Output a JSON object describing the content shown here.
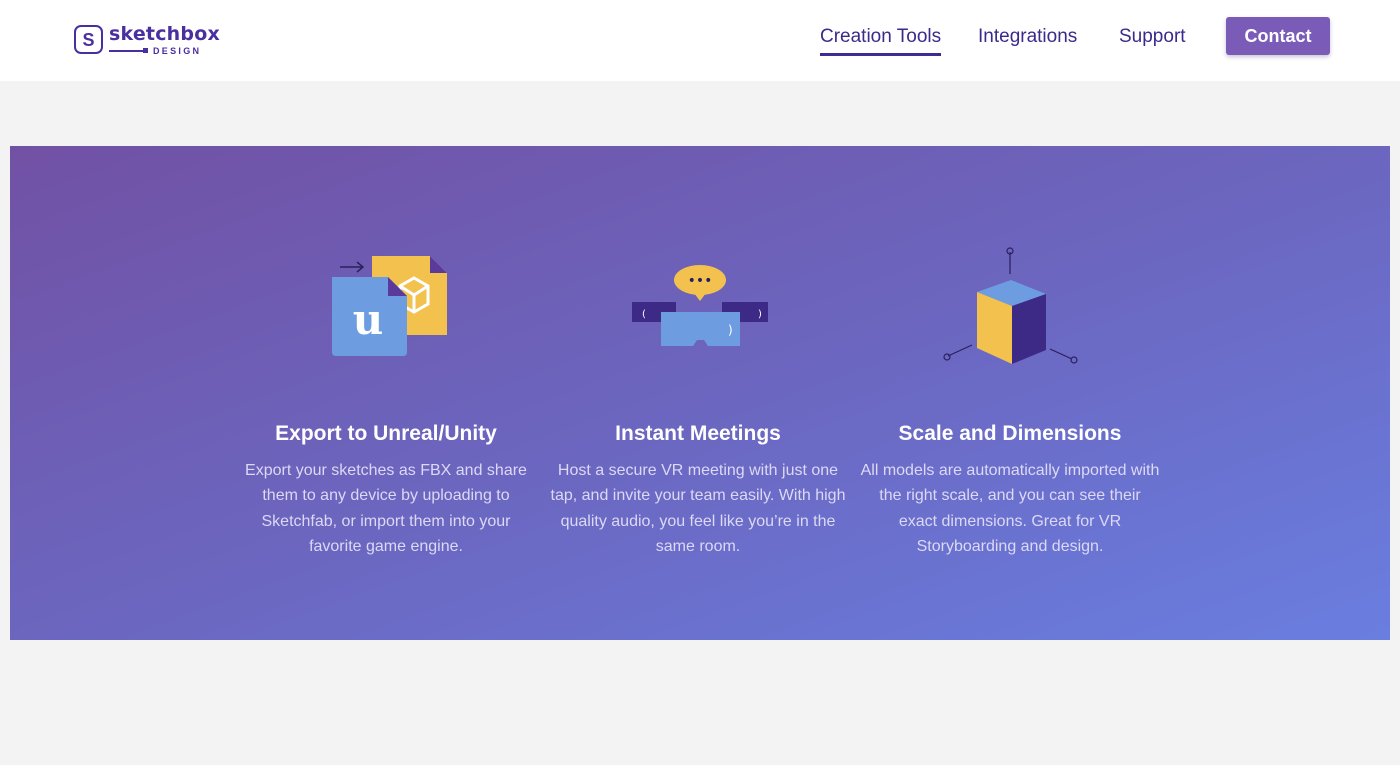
{
  "brand": {
    "badge_letter": "S",
    "name": "sketchbox",
    "sub": "DESIGN",
    "color": "#4a2fa0"
  },
  "nav": {
    "items": [
      {
        "label": "Creation Tools",
        "active": true
      },
      {
        "label": "Integrations",
        "active": false
      },
      {
        "label": "Support",
        "active": false
      }
    ],
    "contact_label": "Contact"
  },
  "features": [
    {
      "icon": "export-files-icon",
      "title": "Export to Unreal/Unity",
      "description": "Export your sketches as FBX and share them to any device by uploading to Sketchfab, or import them into your favorite game engine.",
      "icon_glyph_left": "u"
    },
    {
      "icon": "vr-meeting-icon",
      "title": "Instant Meetings",
      "description": "Host a secure VR meeting with just one tap, and invite your team easily. With high quality audio, you feel like you’re in the same room.",
      "bubble_text": "•••"
    },
    {
      "icon": "scale-cube-icon",
      "title": "Scale and Dimensions",
      "description": "All models are automatically imported with the right scale, and you can see their exact dimensions. Great for VR Storyboarding and design."
    }
  ],
  "colors": {
    "accent": "#7a5bb8",
    "nav_text": "#3a2a8c",
    "band_start": "#7151a4",
    "band_end": "#6a7ee0",
    "yellow": "#f2c14e",
    "blue": "#6d9de0"
  }
}
